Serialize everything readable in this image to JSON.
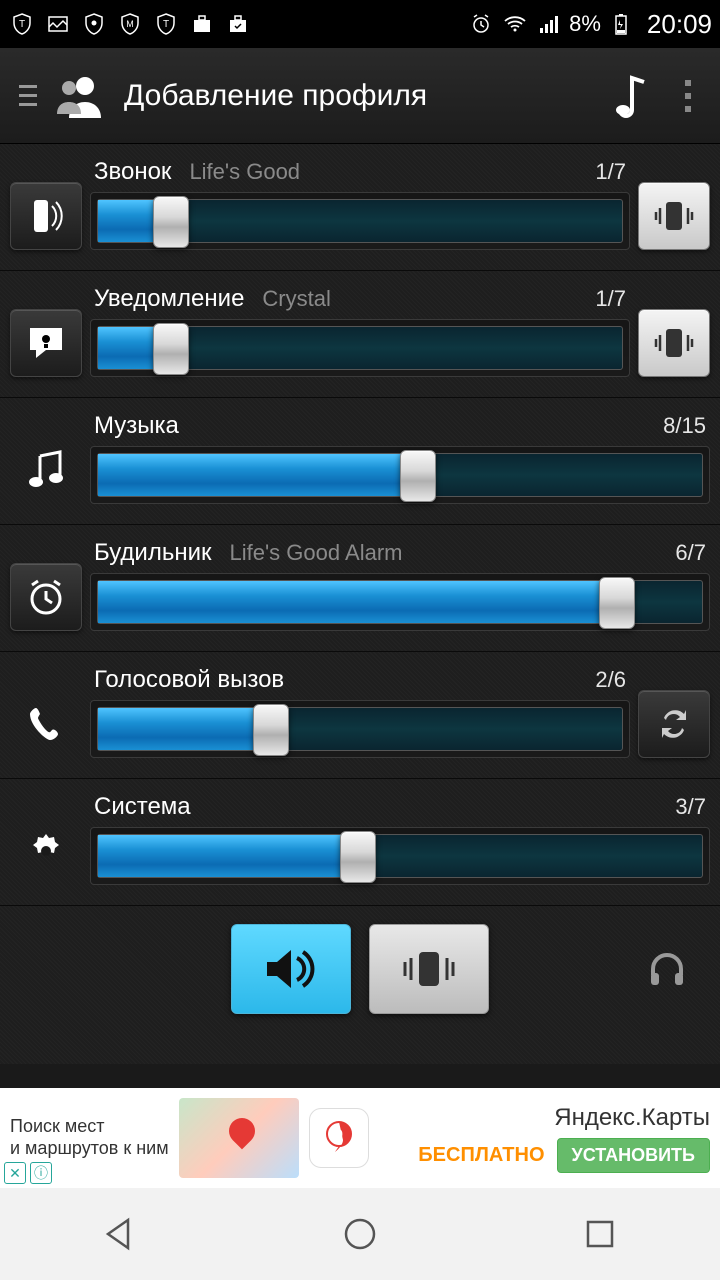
{
  "statusbar": {
    "battery": "8%",
    "clock": "20:09"
  },
  "appbar": {
    "title": "Добавление профиля"
  },
  "rows": [
    {
      "name": "Звонок",
      "sound": "Life's Good",
      "count": "1/7",
      "pct": 14,
      "leftButton": true,
      "rightVibe": true
    },
    {
      "name": "Уведомление",
      "sound": "Crystal",
      "count": "1/7",
      "pct": 14,
      "leftButton": true,
      "rightVibe": true
    },
    {
      "name": "Музыка",
      "sound": "",
      "count": "8/15",
      "pct": 53,
      "leftButton": false,
      "rightVibe": false
    },
    {
      "name": "Будильник",
      "sound": "Life's Good Alarm",
      "count": "6/7",
      "pct": 86,
      "leftButton": true,
      "rightVibe": false
    },
    {
      "name": "Голосовой вызов",
      "sound": "",
      "count": "2/6",
      "pct": 33,
      "leftButton": false,
      "rightRefresh": true
    },
    {
      "name": "Система",
      "sound": "",
      "count": "3/7",
      "pct": 43,
      "leftButton": false,
      "rightVibe": false
    }
  ],
  "ad": {
    "line1": "Поиск мест",
    "line2": "и маршрутов к ним",
    "title": "Яндекс.Карты",
    "free": "БЕСПЛАТНО",
    "install": "УСТАНОВИТЬ"
  }
}
